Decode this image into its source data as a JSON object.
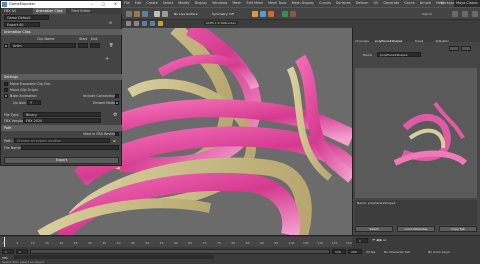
{
  "window": {
    "title": "GameExporter"
  },
  "exporter": {
    "tabs": [
      "FBX All",
      "Animation Clips",
      "Time Editor"
    ],
    "preset": "Game Default",
    "export_all": "Export All",
    "clips_header": "Animation Clips",
    "col_clip_name": "Clip Name",
    "col_start": "Start",
    "col_end": "End",
    "clip_name": "Anim",
    "settings_header": "Settings",
    "opt_move_origin": "Move Exported Clip Frm.",
    "opt_move_root": "Move Clip Origin",
    "opt_bake": "Bake Animation",
    "opt_blend": "Include Connections",
    "opt_up_axis": "Up Axis",
    "up_axis_value": "Y",
    "opt_embed": "Embed Media",
    "file_type_label": "File Type",
    "file_type_value": "Binary",
    "fbx_version_label": "FBX Version",
    "fbx_version_value": "FBX 2020",
    "path_header": "Path",
    "view_log": "View In FBX Review",
    "path_label": "Path:",
    "path_placeholder": "Choose an export location",
    "file_name_label": "File Name:",
    "export_button": "Export"
  },
  "menubar": [
    "File",
    "Edit",
    "Create",
    "Select",
    "Modify",
    "Display",
    "Windows",
    "Mesh",
    "Edit Mesh",
    "Mesh Tools",
    "Mesh Display",
    "Curves",
    "Surfaces",
    "Deform",
    "UV",
    "Generate",
    "Cache",
    "Arnold",
    "Help"
  ],
  "workspace": {
    "label": "Workspace:",
    "value": "Maya Classic"
  },
  "toolbar": {
    "no_live": "No Live Surface",
    "symmetry": "Symmetry: Off",
    "sign_in": "Sign In"
  },
  "viewport": {
    "camera_label": "persp",
    "panel_label": "ACES 1.0 SDR-video"
  },
  "channelbox": {
    "tabs": [
      "Channels",
      "polyPlane1Shape1",
      "time1",
      "defaultAr"
    ],
    "name_label": "Name",
    "node_name": "polyPlane1Shape1",
    "status": "Name: polyPlane1Shape1",
    "buttons": [
      "Select",
      "Load Attributes",
      "Copy Tab"
    ]
  },
  "timeline": {
    "ticks": [
      "1",
      "5",
      "10",
      "15",
      "20",
      "25",
      "30",
      "35",
      "40",
      "45",
      "50",
      "55",
      "60",
      "65",
      "70",
      "75",
      "80",
      "85",
      "90",
      "95",
      "100",
      "105",
      "110",
      "115",
      "120"
    ],
    "start": "1",
    "end": "120",
    "current": "1",
    "range_start": "1",
    "range_end": "200",
    "fps": "24 fps",
    "character_set": "No Character Set",
    "anim_layer": "No Anim Layer",
    "mel": "MEL",
    "help_line": "Select Tool: select an object"
  },
  "colors": {
    "accent": "#5285a6",
    "pink": "#e0409a",
    "panel": "#444444"
  }
}
